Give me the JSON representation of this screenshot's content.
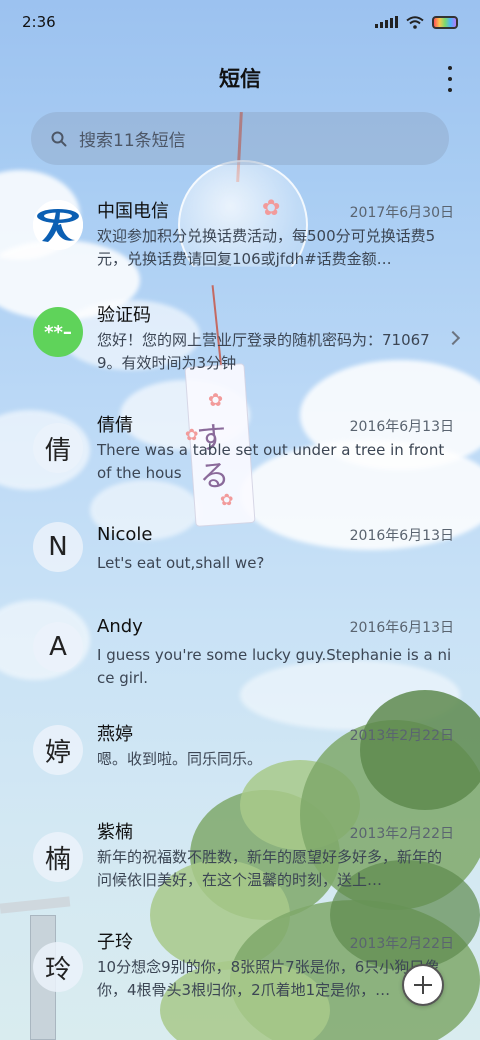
{
  "status_bar": {
    "time": "2:36"
  },
  "header": {
    "title": "短信",
    "more_icon": "more-vertical-icon"
  },
  "search": {
    "placeholder": "搜索11条短信",
    "icon": "search-icon"
  },
  "conversations": [
    {
      "name": "中国电信",
      "date": "2017年6月30日",
      "preview": "欢迎参加积分兑换话费活动，每500分可兑换话费5元，兑换话费请回复106或jfdh#话费金额…",
      "avatar_text": "",
      "avatar_type": "china-telecom-logo"
    },
    {
      "name": "验证码",
      "date": "",
      "preview": "您好！您的网上营业厅登录的随机密码为：710679。有效时间为3分钟",
      "avatar_text": "**–",
      "avatar_type": "verification-code"
    },
    {
      "name": "倩倩",
      "date": "2016年6月13日",
      "preview": "There was a table set out under a tree in front of the hous",
      "avatar_text": "倩"
    },
    {
      "name": "Nicole",
      "date": "2016年6月13日",
      "preview": "Let's eat out,shall we?",
      "avatar_text": "N"
    },
    {
      "name": "Andy",
      "date": "2016年6月13日",
      "preview": "I guess you're some lucky guy.Stephanie is a nice girl.",
      "avatar_text": "A"
    },
    {
      "name": "燕婷",
      "date": "2013年2月22日",
      "preview": "嗯。收到啦。同乐同乐。",
      "avatar_text": "婷"
    },
    {
      "name": "紫楠",
      "date": "2013年2月22日",
      "preview": "新年的祝福数不胜数，新年的愿望好多好多，新年的问候依旧美好，在这个温馨的时刻，送上…",
      "avatar_text": "楠"
    },
    {
      "name": "子玲",
      "date": "2013年2月22日",
      "preview": "10分想念9别的你，8张照片7张是你，6只小狗只像你，4根骨头3根归你，2爪着地1定是你，…",
      "avatar_text": "玲"
    }
  ],
  "colors": {
    "verification_avatar": "#5fd35a",
    "telecom_blue": "#0b5fb3"
  },
  "fab": {
    "icon": "add-icon"
  }
}
